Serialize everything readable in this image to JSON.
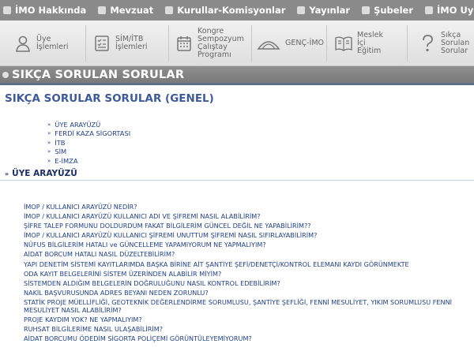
{
  "top_nav": {
    "items": [
      {
        "label": "İMO Hakkında"
      },
      {
        "label": "Mevzuat"
      },
      {
        "label": "Kurullar-Komisyonlar"
      },
      {
        "label": "Yayınlar"
      },
      {
        "label": "Şubeler"
      },
      {
        "label": "İMO Uygulama B"
      }
    ]
  },
  "icon_bar": {
    "items": [
      {
        "label": "Üye\nİşlemleri",
        "icon": "user-icon"
      },
      {
        "label": "SİM/İTB\nİşlemleri",
        "icon": "checklist-icon"
      },
      {
        "label": "Kongre\nSempozyum\nÇalıştay\nProgramı",
        "icon": "calendar-icon"
      },
      {
        "label": "GENÇ-İMO",
        "icon": "dome-icon"
      },
      {
        "label": "Meslek\nİçi\nEğitim",
        "icon": "book-icon"
      },
      {
        "label": "Sıkça\nSorulan\nSorular",
        "icon": "question-icon"
      }
    ]
  },
  "title_bar": {
    "text": "SIKÇA SORULAN SORULAR"
  },
  "subtitle": "SIKÇA SORULAR SORULAR (GENEL)",
  "categories": [
    {
      "label": "ÜYE ARAYÜZÜ"
    },
    {
      "label": "FERDİ KAZA SİGORTASI"
    },
    {
      "label": "İTB"
    },
    {
      "label": "SİM"
    },
    {
      "label": "E-İMZA"
    }
  ],
  "section": {
    "title": "ÜYE ARAYÜZÜ"
  },
  "questions": [
    {
      "text": "İMOP / KULLANICI ARAYÜZÜ NEDİR?"
    },
    {
      "text": "İMOP / KULLANICI ARAYÜZÜ KULLANICI ADI VE ŞİFREMİ NASIL ALABİLİRİM?"
    },
    {
      "text": "ŞİFRE TALEP FORMUNU DOLDURDUM FAKAT BİLGİLERİM GÜNCEL DEĞİL NE YAPABİLİRİM??"
    },
    {
      "text": "İMOP / KULLANICI ARAYÜZÜ KULLANICI ŞİFREMİ UNUTTUM ŞİFREMİ NASIL SIFIRLAYABİLİRİM?"
    },
    {
      "text": "NÜFUS BİLGİLERİM HATALI ve GÜNCELLEME YAPAMIYORUM NE YAPMALIYIM?"
    },
    {
      "text": "AİDAT BORCUM HATALI NASIL DÜZELTEBİLİRİM?"
    },
    {
      "text": "YAPI DENETİM SİSTEMİ KAYITLARIMDA BAŞKA BİRİNE AİT ŞANTİYE ŞEFİ/DENETÇİ/KONTROL ELEMANI KAYDI GÖRÜNMEKTE"
    },
    {
      "text": "ODA KAYIT BELGELERİNİ SİSTEM ÜZERİNDEN ALABİLİR MİYİM?"
    },
    {
      "text": "SİSTEMDEN ALDIĞIM BELGELERİN DOĞRULUĞUNU NASIL KONTROL EDEBİLİRİM?"
    },
    {
      "text": "NAKİL BAŞVURUSUNDA ADRES BEYANI NEDEN ZORUNLU?"
    },
    {
      "text": "STATİK PROJE MÜELLİFLİĞİ, GEOTEKNİK DEĞERLENDİRME SORUMLUSU, ŞANTİYE ŞEFLİĞİ, FENNİ MESULİYET, YIKIM SORUMLUSU FENNİ MESULİYET NASIL ALABİLİRİM?"
    },
    {
      "text": "PROJE KAYDIM YOK? NE YAPMALIYIM?"
    },
    {
      "text": "RUHSAT BİLGİLERİME NASIL ULAŞABİLİRİM?"
    },
    {
      "text": "AİDAT BORCUMU ÖDEDİM SİGORTA POLİÇEMİ GÖRÜNTÜLEYEMİYORUM?"
    }
  ]
}
